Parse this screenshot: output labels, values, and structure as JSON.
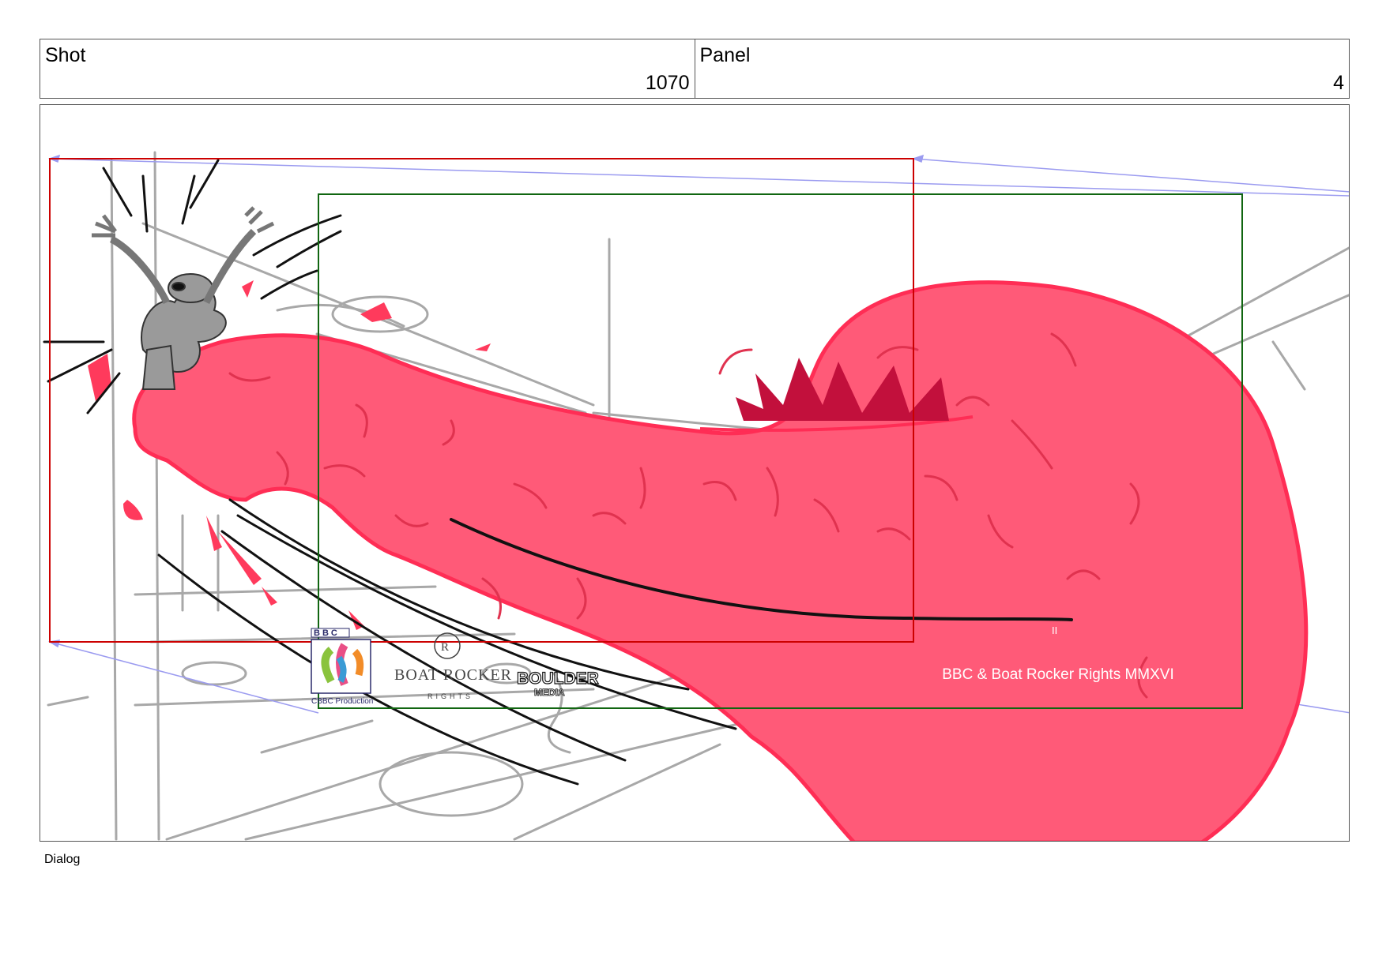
{
  "header": {
    "shot_label": "Shot",
    "shot_number": "1070",
    "panel_label": "Panel",
    "panel_number": "4"
  },
  "frame": {
    "logos": {
      "bbc_mark": "BBC",
      "cbbc_caption": "CBBC Production",
      "boat_rocker_name": "BOAT ROCKER",
      "boat_rocker_sub": "RIGHTS",
      "boulder_name": "BOULDER",
      "boulder_sub": "MEDIA"
    },
    "copyright": "BBC & Boat Rocker Rights MMXVI",
    "colors": {
      "tongue": "#ff5a78",
      "tongue_line": "#ff2d55",
      "teeth": "#c2103c",
      "red_frame": "#cc0000",
      "green_frame": "#116611",
      "camera_arrow": "#9b9bf0"
    }
  },
  "footer": {
    "dialog_label": "Dialog"
  }
}
